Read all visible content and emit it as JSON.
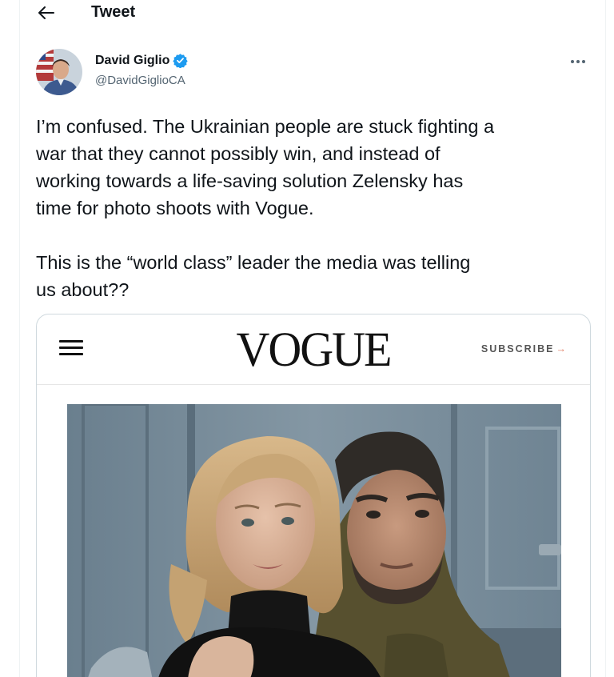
{
  "header": {
    "title": "Tweet",
    "back_icon": "arrow-left-icon"
  },
  "author": {
    "name": "David Giglio",
    "handle": "@DavidGiglioCA",
    "verified": true,
    "verified_color": "#1d9bf0"
  },
  "tweet": {
    "lines_p1": [
      "I’m confused. The Ukrainian people are stuck fighting a",
      "war that they cannot possibly win, and instead of",
      "working towards a life-saving solution Zelensky has",
      "time for photo shoots with Vogue."
    ],
    "lines_p2": [
      "This is the “world class” leader the media was telling",
      "us about??"
    ]
  },
  "card": {
    "brand": "VOGUE",
    "subscribe_label": "SUBSCRIBE",
    "subscribe_arrow": "→",
    "menu_icon": "hamburger-menu-icon",
    "photo_icon": "portrait-photo"
  }
}
